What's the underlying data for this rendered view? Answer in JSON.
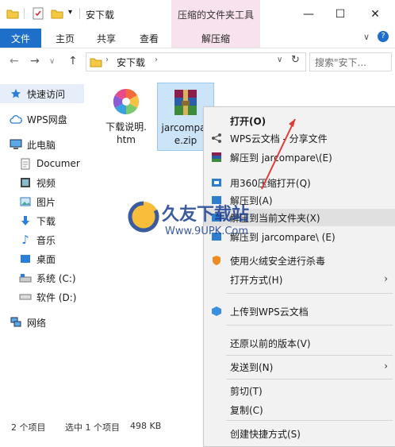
{
  "window": {
    "title": "安下载",
    "tool_tab": "压缩的文件夹工具",
    "minimize": "—",
    "maximize": "☐",
    "close": "✕"
  },
  "ribbon": {
    "file": "文件",
    "home": "主页",
    "share": "共享",
    "view": "查看",
    "extract": "解压缩"
  },
  "address": {
    "path_label": "安下载",
    "search_placeholder": "搜索\"安下..."
  },
  "sidebar": {
    "items": [
      {
        "label": "快速访问"
      },
      {
        "label": "WPS网盘"
      },
      {
        "label": "此电脑"
      },
      {
        "label": "Documer"
      },
      {
        "label": "视频"
      },
      {
        "label": "图片"
      },
      {
        "label": "下载"
      },
      {
        "label": "音乐"
      },
      {
        "label": "桌面"
      },
      {
        "label": "系统 (C:)"
      },
      {
        "label": "软件 (D:)"
      },
      {
        "label": "网络"
      }
    ]
  },
  "files": [
    {
      "line1": "下载说明.",
      "line2": "htm"
    },
    {
      "line1": "jarcompar",
      "line2": "e.zip"
    }
  ],
  "context_menu": {
    "items": [
      {
        "label": "打开(O)"
      },
      {
        "label": "WPS云文档 - 分享文件"
      },
      {
        "label": "解压到 jarcompare\\(E)"
      },
      {
        "label": "用360压缩打开(Q)"
      },
      {
        "label": "解压到(A)"
      },
      {
        "label": "解压到当前文件夹(X)"
      },
      {
        "label": "解压到 jarcompare\\ (E)"
      },
      {
        "label": "使用火绒安全进行杀毒"
      },
      {
        "label": "打开方式(H)"
      },
      {
        "label": "上传到WPS云文档"
      },
      {
        "label": "还原以前的版本(V)"
      },
      {
        "label": "发送到(N)"
      },
      {
        "label": "剪切(T)"
      },
      {
        "label": "复制(C)"
      },
      {
        "label": "创建快捷方式(S)"
      }
    ],
    "submenu_arrow": "›"
  },
  "status": {
    "count": "2 个项目",
    "selected": "选中 1 个项目",
    "size": "498 KB"
  },
  "watermark": {
    "brand": "久友下载站",
    "url": "Www.9UPK.Com"
  },
  "colors": {
    "accent": "#1e6fc9",
    "tool_tab": "#f8e2ee",
    "selection": "#cce4f7",
    "annotation_arrow": "#e53935"
  }
}
